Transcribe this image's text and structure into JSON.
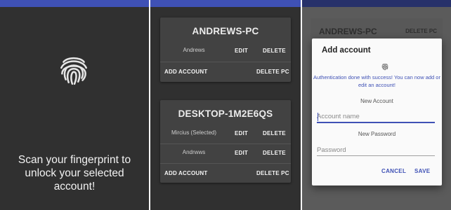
{
  "colors": {
    "accent": "#3f51b5",
    "panel_background": "#303030",
    "card_background": "#424242"
  },
  "scan_screen": {
    "icon": "fingerprint-icon",
    "message": "Scan your fingerprint to unlock your selected account!"
  },
  "pc_list": {
    "cards": [
      {
        "title": "ANDREWS-PC",
        "accounts": [
          {
            "name": "Andrews",
            "edit": "EDIT",
            "delete": "DELETE"
          }
        ],
        "add_account": "ADD ACCOUNT",
        "delete_pc": "DELETE PC"
      },
      {
        "title": "DESKTOP-1M2E6QS",
        "accounts": [
          {
            "name": "Mircius (Selected)",
            "edit": "EDIT",
            "delete": "DELETE"
          },
          {
            "name": "Andrwws",
            "edit": "EDIT",
            "delete": "DELETE"
          }
        ],
        "add_account": "ADD ACCOUNT",
        "delete_pc": "DELETE PC"
      }
    ]
  },
  "add_account_screen": {
    "background_card": {
      "title": "ANDREWS-PC",
      "delete_pc": "DELETE PC"
    },
    "dialog": {
      "title": "Add account",
      "icon": "fingerprint-icon",
      "success_message": "Authentication done with success! You can now add or edit an account!",
      "account_label": "New Account",
      "account_placeholder": "Account name",
      "account_value": "",
      "password_label": "New Password",
      "password_placeholder": "Password",
      "password_value": "",
      "cancel": "CANCEL",
      "save": "SAVE"
    }
  }
}
